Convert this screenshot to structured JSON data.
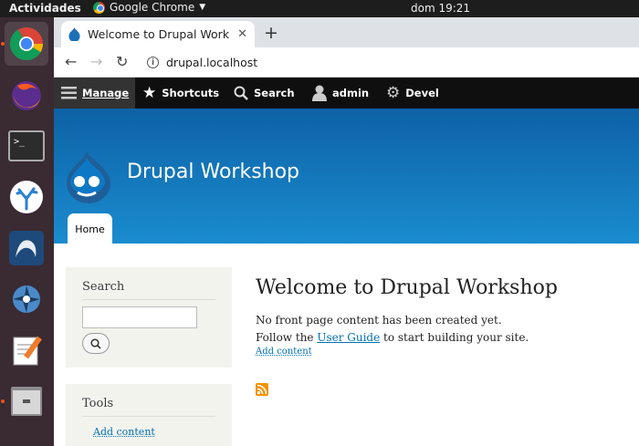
{
  "topbar": {
    "activities": "Actividades",
    "app_name": "Google Chrome",
    "clock": "dom 19:21"
  },
  "dock": {
    "items": [
      "chrome-icon",
      "firefox-icon",
      "terminal-icon",
      "vscode-icon",
      "mysql-workbench-icon",
      "shotwell-icon",
      "text-editor-icon",
      "files-icon"
    ]
  },
  "browser": {
    "tab_title": "Welcome to Drupal Work",
    "url": "drupal.localhost"
  },
  "admin_toolbar": {
    "manage": "Manage",
    "shortcuts": "Shortcuts",
    "search": "Search",
    "user": "admin",
    "devel": "Devel"
  },
  "site": {
    "name": "Drupal Workshop",
    "home_tab": "Home"
  },
  "sidebar": {
    "search_title": "Search",
    "tools_title": "Tools",
    "tools_link": "Add content"
  },
  "main": {
    "heading": "Welcome to Drupal Workshop",
    "line1": "No front page content has been created yet.",
    "line2_prefix": "Follow the ",
    "line2_link": "User Guide",
    "line2_suffix": " to start building your site.",
    "add_content": "Add content"
  },
  "colors": {
    "drupal_blue": "#0d62a5",
    "link": "#0071b3",
    "admin_bar": "#0f0f0f"
  }
}
